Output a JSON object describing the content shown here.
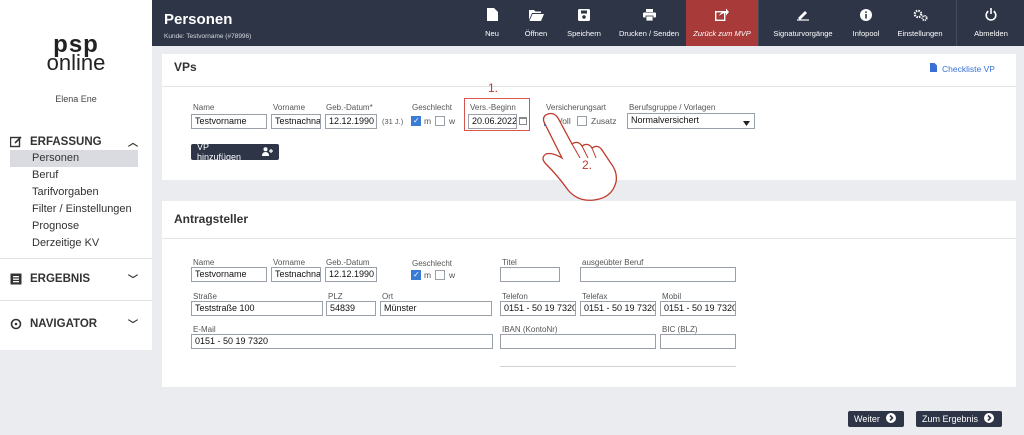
{
  "brand": {
    "line1": "psp",
    "line2": "online"
  },
  "user": {
    "name": "Elena Ene"
  },
  "sidebar": {
    "erfassung": {
      "label": "ERFASSUNG",
      "icon": "edit-icon"
    },
    "items": [
      {
        "label": "Personen",
        "active": true
      },
      {
        "label": "Beruf"
      },
      {
        "label": "Tarifvorgaben"
      },
      {
        "label": "Filter / Einstellungen"
      },
      {
        "label": "Prognose"
      },
      {
        "label": "Derzeitige KV"
      }
    ],
    "ergebnis": {
      "label": "ERGEBNIS",
      "icon": "list-icon"
    },
    "navigator": {
      "label": "NAVIGATOR",
      "icon": "crosshair-icon"
    }
  },
  "header": {
    "title": "Personen",
    "subtitle": "Kunde: Testvorname (#78996)",
    "buttons": [
      {
        "label": "Neu",
        "icon": "file-icon"
      },
      {
        "label": "Öffnen",
        "icon": "folder-open-icon"
      },
      {
        "label": "Speichern",
        "icon": "save-icon"
      },
      {
        "label": "Drucken / Senden",
        "icon": "print-icon"
      },
      {
        "label": "Zurück zum MVP",
        "icon": "share-icon"
      },
      {
        "label": "Signaturvorgänge",
        "icon": "signature-icon"
      },
      {
        "label": "Infopool",
        "icon": "info-icon"
      },
      {
        "label": "Einstellungen",
        "icon": "gears-icon"
      },
      {
        "label": "Abmelden",
        "icon": "power-icon"
      }
    ],
    "colors": {
      "bar": "#2e3547",
      "highlight": "#a83a3a"
    }
  },
  "vps": {
    "title": "VPs",
    "checkliste": "Checkliste VP",
    "labels": {
      "name": "Name",
      "vorname": "Vorname",
      "geb": "Geb.-Datum*",
      "geschlecht": "Geschlecht",
      "versbeginn": "Vers.-Beginn",
      "versart": "Versicherungsart",
      "berufsgruppe": "Berufsgruppe / Vorlagen"
    },
    "values": {
      "name": "Testvorname",
      "vorname": "Testnachname",
      "geb": "12.12.1990",
      "age": "(31 J.)",
      "m": "m",
      "w": "w",
      "versbeginn": "20.06.2022",
      "voll": "Voll",
      "zusatz": "Zusatz",
      "berufsgruppe": "Normalversichert"
    },
    "add_button": "VP hinzufügen",
    "annotation1": "1.",
    "annotation2": "2."
  },
  "antrag": {
    "title": "Antragsteller",
    "labels": {
      "name": "Name",
      "vorname": "Vorname",
      "geb": "Geb.-Datum",
      "geschlecht": "Geschlecht",
      "titel": "Titel",
      "beruf": "ausgeübter Beruf",
      "strasse": "Straße",
      "plz": "PLZ",
      "ort": "Ort",
      "telefon": "Telefon",
      "telefax": "Telefax",
      "mobil": "Mobil",
      "email": "E-Mail",
      "iban": "IBAN (KontoNr)",
      "bic": "BIC (BLZ)"
    },
    "values": {
      "name": "Testvorname",
      "vorname": "Testnachname",
      "geb": "12.12.1990",
      "m": "m",
      "w": "w",
      "titel": "",
      "beruf": "",
      "strasse": "Teststraße 100",
      "plz": "54839",
      "ort": "Münster",
      "telefon": "0151 - 50 19 7320",
      "telefax": "0151 - 50 19 7320",
      "mobil": "0151 - 50 19 7320",
      "email": "0151 - 50 19 7320",
      "iban": "",
      "bic": ""
    }
  },
  "footer": {
    "weiter": "Weiter",
    "ergebnis": "Zum Ergebnis"
  }
}
